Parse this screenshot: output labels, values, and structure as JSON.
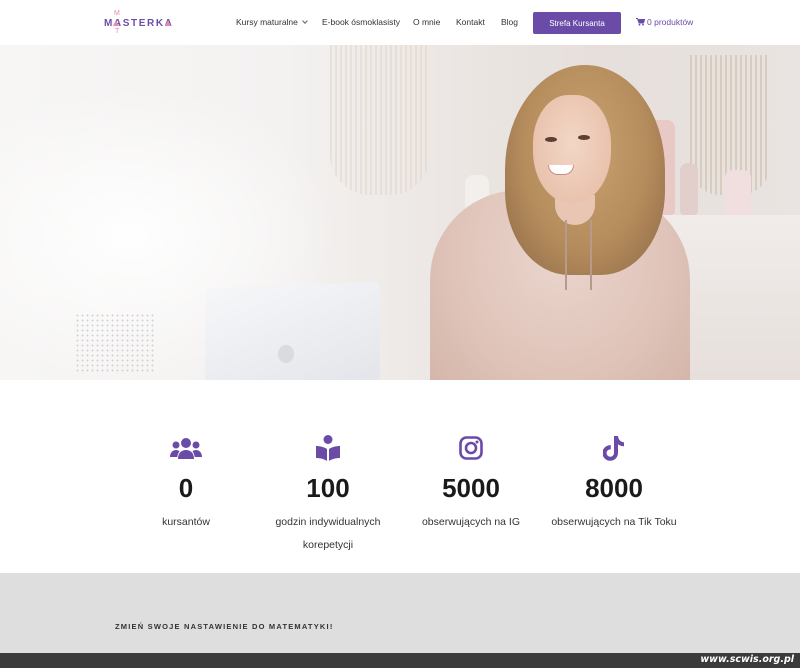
{
  "header": {
    "logo": {
      "main": "MASTERKA",
      "top_letter": "M",
      "bottom_letter": "T"
    },
    "nav": [
      {
        "label": "Kursy maturalne",
        "has_dropdown": true
      },
      {
        "label": "E-book ósmoklasisty"
      },
      {
        "label": "O mnie"
      },
      {
        "label": "Kontakt"
      },
      {
        "label": "Blog"
      }
    ],
    "cta_label": "Strefa Kursanta",
    "cart_label": "0 produktów"
  },
  "stats": [
    {
      "icon": "users-icon",
      "value": "0",
      "label": "kursantów"
    },
    {
      "icon": "book-reader-icon",
      "value": "100",
      "label": "godzin indywidualnych korepetycji"
    },
    {
      "icon": "instagram-icon",
      "value": "5000",
      "label": "obserwujących na IG"
    },
    {
      "icon": "tiktok-icon",
      "value": "8000",
      "label": "obserwujących na Tik Toku"
    }
  ],
  "section": {
    "heading": "ZMIEŃ SWOJE NASTAWIENIE DO MATEMATYKI!"
  },
  "watermark": "www.scwis.org.pl",
  "colors": {
    "accent": "#6a4ba8",
    "logo_pink": "#e48ab1",
    "grey_band": "#dedede",
    "footer": "#3b3b3b"
  }
}
